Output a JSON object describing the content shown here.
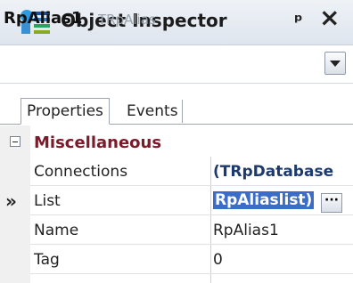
{
  "window": {
    "title": "Object Inspector",
    "pin_glyph": "ᵖ",
    "close_glyph": "×"
  },
  "selector": {
    "name": "RpAlias1",
    "type": "TRpAlias"
  },
  "tabs": [
    {
      "label": "Properties",
      "active": true
    },
    {
      "label": "Events",
      "active": false
    }
  ],
  "category": {
    "label": "Miscellaneous",
    "expander_glyph": "−"
  },
  "properties": [
    {
      "name": "Connections",
      "value": "(TRpDatabase"
    },
    {
      "name": "List",
      "value": "RpAliaslist)",
      "selected": true,
      "ellipsis": "···"
    },
    {
      "name": "Name",
      "value": "RpAlias1"
    },
    {
      "name": "Tag",
      "value": "0"
    }
  ],
  "current_marker": "»",
  "colors": {
    "category_text": "#7a1a2b",
    "selection_bg": "#3a6cc8"
  }
}
